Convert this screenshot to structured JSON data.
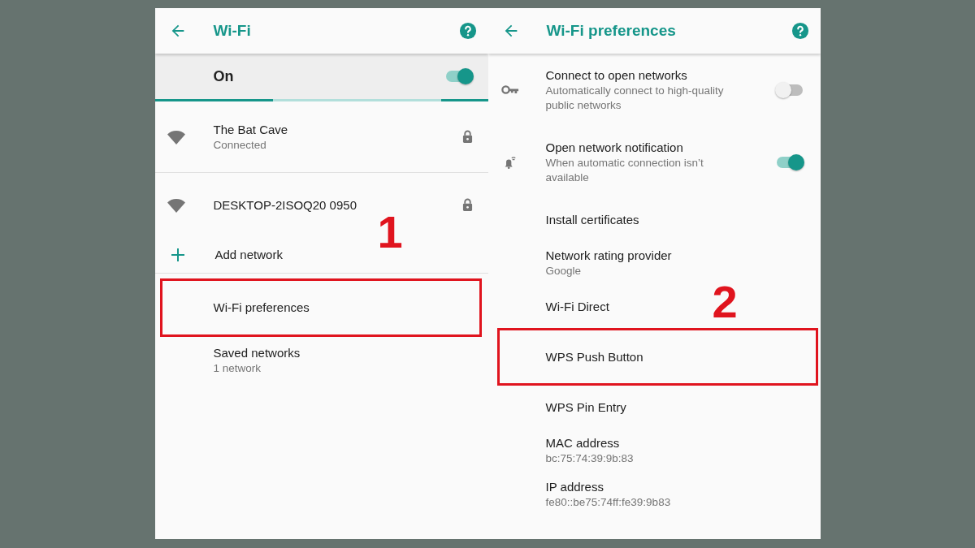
{
  "left_screen": {
    "title": "Wi-Fi",
    "master_switch": {
      "label": "On",
      "on": true
    },
    "scanning": true,
    "networks": [
      {
        "name": "The Bat Cave",
        "status": "Connected",
        "secured": true
      },
      {
        "name": "DESKTOP-2ISOQ20 0950",
        "secured": true
      }
    ],
    "add_network": {
      "label": "Add network"
    },
    "items": [
      {
        "title": "Wi-Fi preferences",
        "highlighted": true
      },
      {
        "title": "Saved networks",
        "subtitle": "1 network",
        "highlighted": false
      }
    ],
    "annotation": "1"
  },
  "right_screen": {
    "title": "Wi-Fi preferences",
    "settings": [
      {
        "kind": "toggle",
        "title": "Connect to open networks",
        "subtitle": "Automatically connect to high-quality public networks",
        "on": false,
        "highlighted": false
      },
      {
        "kind": "toggle",
        "title": "Open network notification",
        "subtitle": "When automatic connection isn’t available",
        "on": true,
        "highlighted": false
      },
      {
        "kind": "link",
        "title": "Install certificates",
        "highlighted": false
      },
      {
        "kind": "link",
        "title": "Network rating provider",
        "subtitle": "Google",
        "highlighted": false
      },
      {
        "kind": "link",
        "title": "Wi-Fi Direct",
        "highlighted": false
      },
      {
        "kind": "link",
        "title": "WPS Push Button",
        "highlighted": true
      },
      {
        "kind": "link",
        "title": "WPS Pin Entry",
        "highlighted": false
      },
      {
        "kind": "info",
        "title": "MAC address",
        "subtitle": "bc:75:74:39:9b:83",
        "highlighted": false
      },
      {
        "kind": "info",
        "title": "IP address",
        "subtitle": "fe80::be75:74ff:fe39:9b83",
        "highlighted": false
      }
    ],
    "annotation": "2"
  }
}
